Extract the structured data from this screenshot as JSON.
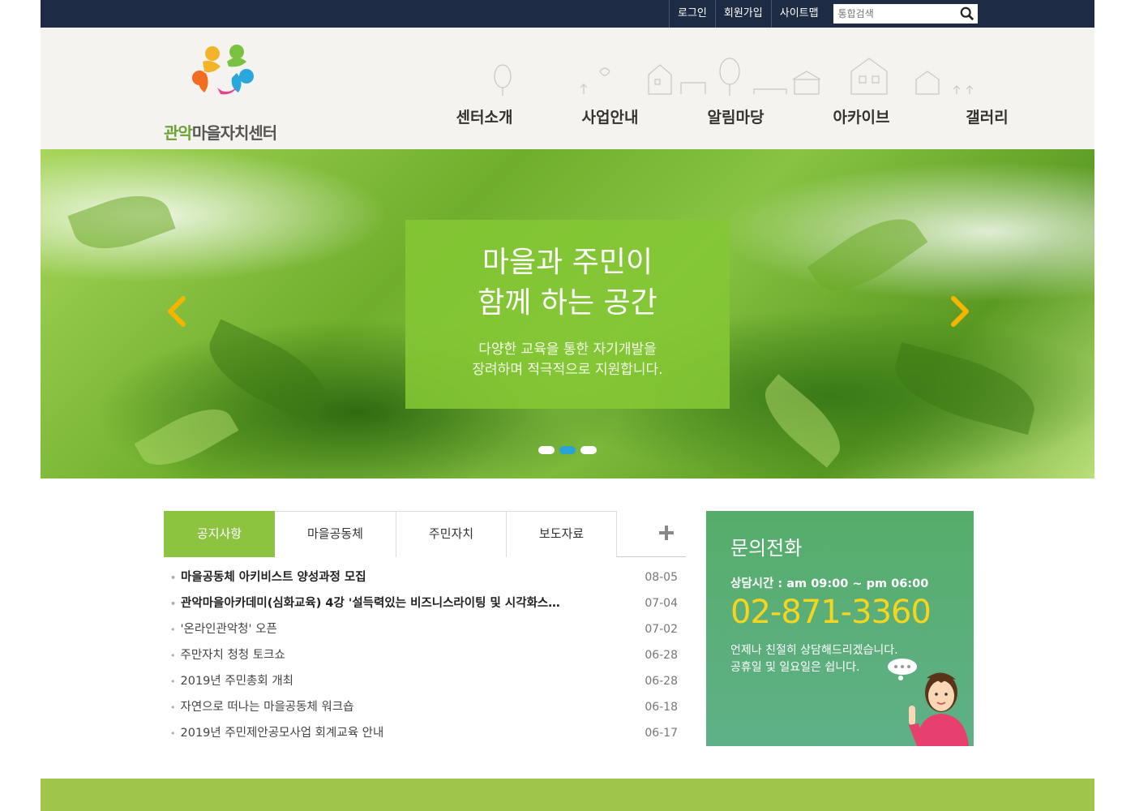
{
  "util": {
    "login": "로그인",
    "signup": "회원가입",
    "sitemap": "사이트맵",
    "search_placeholder": "통합검색"
  },
  "logo": {
    "part1": "관악",
    "part2": "마을자치센터"
  },
  "gnb": [
    "센터소개",
    "사업안내",
    "알림마당",
    "아카이브",
    "갤러리"
  ],
  "hero": {
    "title": "마을과 주민이\n함께 하는 공간",
    "sub": "다양한 교육을 통한 자기개발을\n장려하며 적극적으로 지원합니다.",
    "active_slide": 2,
    "slides": 3
  },
  "tabs": [
    "공지사항",
    "마을공동체",
    "주민자치",
    "보도자료"
  ],
  "notices": [
    {
      "title": "마을공동체 아키비스트 양성과정 모집",
      "date": "08-05",
      "bold": true
    },
    {
      "title": "관악마을아카데미(심화교육) 4강 '설득력있는 비즈니스라이팅 및 시각화스…",
      "date": "07-04",
      "bold": true
    },
    {
      "title": "'온라인관악청' 오픈",
      "date": "07-02",
      "bold": false
    },
    {
      "title": "주만자치 청청 토크쇼",
      "date": "06-28",
      "bold": false
    },
    {
      "title": "2019년 주민총회 개최",
      "date": "06-28",
      "bold": false
    },
    {
      "title": "자연으로 떠나는 마을공동체 워크숍",
      "date": "06-18",
      "bold": false
    },
    {
      "title": "2019년 주민제안공모사업 회계교육 안내",
      "date": "06-17",
      "bold": false
    }
  ],
  "contact": {
    "title": "문의전화",
    "hours": "상담시간 : am 09:00 ~ pm 06:00",
    "phone": "02-871-3360",
    "desc": "언제나 친절히 상담해드리겠습니다.\n공휴일 및 일요일은 쉽니다."
  },
  "colors": {
    "topbar": "#1d2b45",
    "accent_green": "#8cc43f",
    "phone_yellow": "#f7d51f",
    "contact_green": "#56ad6a"
  }
}
